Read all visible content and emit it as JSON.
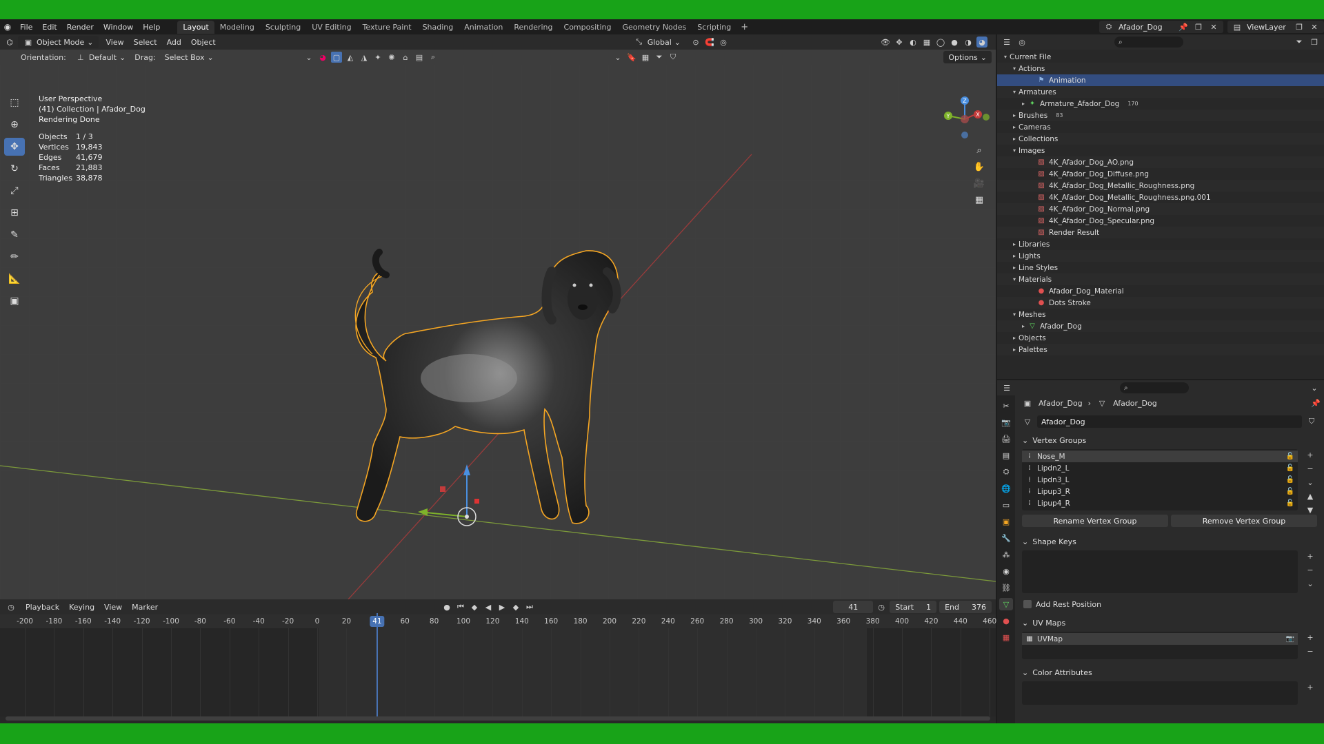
{
  "menu": {
    "items": [
      "File",
      "Edit",
      "Render",
      "Window",
      "Help"
    ]
  },
  "workspaces": [
    "Layout",
    "Modeling",
    "Sculpting",
    "UV Editing",
    "Texture Paint",
    "Shading",
    "Animation",
    "Rendering",
    "Compositing",
    "Geometry Nodes",
    "Scripting"
  ],
  "active_workspace": "Layout",
  "scene": {
    "name": "Afador_Dog",
    "view_layer": "ViewLayer"
  },
  "viewport": {
    "mode": "Object Mode",
    "menus": [
      "View",
      "Select",
      "Add",
      "Object"
    ],
    "transform": "Global",
    "orientation_label": "Orientation:",
    "orientation_value": "Default",
    "drag_label": "Drag:",
    "drag_value": "Select Box",
    "options": "Options",
    "overlay_lines": [
      "User Perspective",
      "(41) Collection | Afador_Dog",
      "Rendering Done"
    ],
    "stats": [
      {
        "k": "Objects",
        "v": "1 / 3"
      },
      {
        "k": "Vertices",
        "v": "19,843"
      },
      {
        "k": "Edges",
        "v": "41,679"
      },
      {
        "k": "Faces",
        "v": "21,883"
      },
      {
        "k": "Triangles",
        "v": "38,878"
      }
    ],
    "gizmo_axes": {
      "x": "X",
      "y": "Y",
      "z": "Z"
    }
  },
  "timeline": {
    "menus": [
      "Playback",
      "Keying",
      "View",
      "Marker"
    ],
    "current_frame": "41",
    "start_label": "Start",
    "start": "1",
    "end_label": "End",
    "end": "376",
    "ticks": [
      "-200",
      "-180",
      "-160",
      "-140",
      "-120",
      "-100",
      "-80",
      "-60",
      "-40",
      "-20",
      "0",
      "20",
      "40",
      "60",
      "80",
      "100",
      "120",
      "140",
      "160",
      "180",
      "200",
      "220",
      "240",
      "260",
      "280",
      "300",
      "320",
      "340",
      "360",
      "380",
      "400",
      "420",
      "440",
      "460"
    ]
  },
  "outliner": {
    "rows": [
      {
        "label": "Current File",
        "indent": 0,
        "tri": "▾",
        "icon": ""
      },
      {
        "label": "Actions",
        "indent": 1,
        "tri": "▾",
        "icon": ""
      },
      {
        "label": "Animation",
        "indent": 3,
        "tri": "",
        "icon": "action-icon",
        "sel": true
      },
      {
        "label": "Armatures",
        "indent": 1,
        "tri": "▾",
        "icon": ""
      },
      {
        "label": "Armature_Afador_Dog",
        "indent": 2,
        "tri": "▸",
        "icon": "armature-icon",
        "badge": "170"
      },
      {
        "label": "Brushes",
        "indent": 1,
        "tri": "▸",
        "icon": "",
        "badge": "83"
      },
      {
        "label": "Cameras",
        "indent": 1,
        "tri": "▸",
        "icon": ""
      },
      {
        "label": "Collections",
        "indent": 1,
        "tri": "▸",
        "icon": ""
      },
      {
        "label": "Images",
        "indent": 1,
        "tri": "▾",
        "icon": ""
      },
      {
        "label": "4K_Afador_Dog_AO.png",
        "indent": 3,
        "tri": "",
        "icon": "image-icon"
      },
      {
        "label": "4K_Afador_Dog_Diffuse.png",
        "indent": 3,
        "tri": "",
        "icon": "image-icon"
      },
      {
        "label": "4K_Afador_Dog_Metallic_Roughness.png",
        "indent": 3,
        "tri": "",
        "icon": "image-icon"
      },
      {
        "label": "4K_Afador_Dog_Metallic_Roughness.png.001",
        "indent": 3,
        "tri": "",
        "icon": "image-icon"
      },
      {
        "label": "4K_Afador_Dog_Normal.png",
        "indent": 3,
        "tri": "",
        "icon": "image-icon"
      },
      {
        "label": "4K_Afador_Dog_Specular.png",
        "indent": 3,
        "tri": "",
        "icon": "image-icon"
      },
      {
        "label": "Render Result",
        "indent": 3,
        "tri": "",
        "icon": "image-icon"
      },
      {
        "label": "Libraries",
        "indent": 1,
        "tri": "▸",
        "icon": ""
      },
      {
        "label": "Lights",
        "indent": 1,
        "tri": "▸",
        "icon": ""
      },
      {
        "label": "Line Styles",
        "indent": 1,
        "tri": "▸",
        "icon": ""
      },
      {
        "label": "Materials",
        "indent": 1,
        "tri": "▾",
        "icon": ""
      },
      {
        "label": "Afador_Dog_Material",
        "indent": 3,
        "tri": "",
        "icon": "material-icon"
      },
      {
        "label": "Dots Stroke",
        "indent": 3,
        "tri": "",
        "icon": "material-icon"
      },
      {
        "label": "Meshes",
        "indent": 1,
        "tri": "▾",
        "icon": ""
      },
      {
        "label": "Afador_Dog",
        "indent": 2,
        "tri": "▸",
        "icon": "mesh-icon"
      },
      {
        "label": "Objects",
        "indent": 1,
        "tri": "▸",
        "icon": ""
      },
      {
        "label": "Palettes",
        "indent": 1,
        "tri": "▸",
        "icon": ""
      }
    ]
  },
  "properties": {
    "breadcrumb": [
      "Afador_Dog",
      "Afador_Dog"
    ],
    "data_name": "Afador_Dog",
    "vertex_groups_title": "Vertex Groups",
    "vertex_groups": [
      "Nose_M",
      "Lipdn2_L",
      "Lipdn3_L",
      "Lipup3_R",
      "Lipup4_R"
    ],
    "rename_btn": "Rename Vertex Group",
    "remove_btn": "Remove Vertex Group",
    "shape_keys_title": "Shape Keys",
    "add_rest_position": "Add Rest Position",
    "uv_maps_title": "UV Maps",
    "uv_maps": [
      "UVMap"
    ],
    "color_attributes_title": "Color Attributes"
  },
  "colors": {
    "accent": "#4772b3",
    "selection_outline": "#f5a623",
    "grass_green": "#18a318"
  }
}
